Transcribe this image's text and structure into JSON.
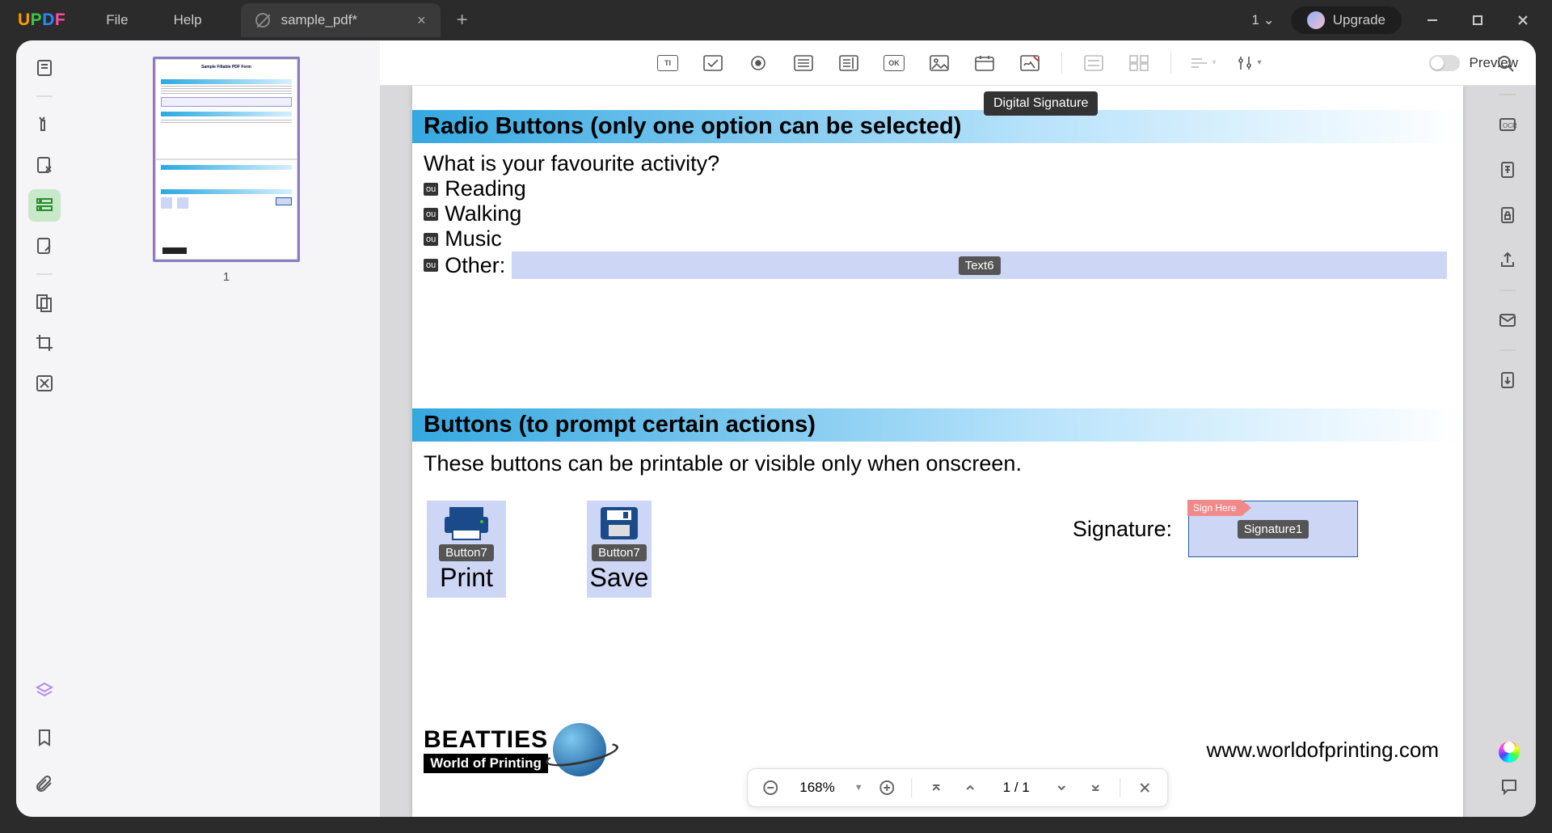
{
  "app": {
    "logo_u": "U",
    "logo_p": "P",
    "logo_d": "D",
    "logo_f": "F"
  },
  "menu": {
    "file": "File",
    "help": "Help"
  },
  "tab": {
    "title": "sample_pdf*"
  },
  "title_right": {
    "count": "1",
    "upgrade": "Upgrade"
  },
  "tooltip": {
    "digital_signature": "Digital Signature"
  },
  "preview_label": "Preview",
  "thumb": {
    "number": "1"
  },
  "page": {
    "radio_heading": "Radio Buttons (only one option can be selected)",
    "radio_question": "What is your favourite activity?",
    "opts": {
      "r1": "Reading",
      "r2": "Walking",
      "r3": "Music",
      "r4": "Other:"
    },
    "radio_badge": "ou",
    "text6_tag": "Text6",
    "buttons_heading": "Buttons (to prompt certain actions)",
    "buttons_desc": "These buttons can be printable or visible only when onscreen.",
    "btn_tag": "Button7",
    "print": "Print",
    "save": "Save",
    "signature_label": "Signature:",
    "signhere": "Sign Here",
    "signature_tag": "Signature1",
    "company": "BEATTIES",
    "company_sub": "World of Printing",
    "url": "www.worldofprinting.com"
  },
  "nav": {
    "zoom": "168%",
    "page_display": "1  /  1"
  },
  "form_tb": {
    "ti": "TI",
    "ok": "OK"
  }
}
